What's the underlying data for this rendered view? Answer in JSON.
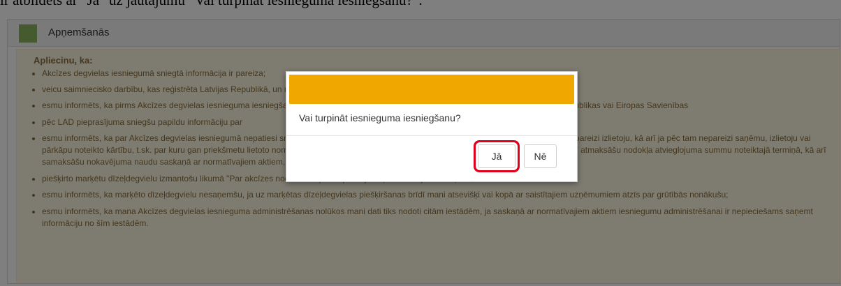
{
  "caption": "ir atbildēts ar \"Jā\" uz jautājumu \"Vai turpināt iesnieguma iesniegšanu?\".",
  "panel": {
    "title": "Apņemšanās",
    "heading": "Apliecinu, ka:",
    "items": [
      "Akcīzes degvielas iesniegumā sniegtā informācija ir pareiza;",
      "veicu saimniecisko darbību, kas reģistrēta Latvijas Republikā, un ražoju lauksaimniecisko vai akvakultūras produkciju;",
      "esmu informēts, ka pirms Akcīzes degvielas iesnieguma iesniegšanas un trīs gadus pēc akcīzes nodokļa atbrīvojuma saņemšanas Latvijas Republikas vai Eiropas Savienības",
      "pēc LAD pieprasījuma sniegšu papildu informāciju par",
      "esmu informēts, ka par Akcīzes degvielas iesniegumā nepatiesi sniegtām ziņām nepamatoti saņemtajām summām, ja nelikumīgi saņēmu vai nepareizi izlietoju, kā arī ja pēc tam nepareizi saņēmu, izlietoju vai pārkāpu noteikto kārtību, t.sk. par kuru gan priekšmetu lietoto normatīvu atbalstu, dēļ kura vai daļēji zaudēšu akcīzes nodokļa atbrīvojumu, kā arī atmaksāšu nodokļa atvieglojuma summu noteiktajā termiņā, kā arī samaksāšu nokavējuma naudu saskaņā ar normatīvajiem aktiem, ja samaksas termiņu nokavēšu;",
      "piešķirto marķētu dīzeļdegvielu izmantošu likumā \"Par akcīzes nodokli\" 18.panta piektajā daļā noteiktajiem mērķiem;",
      "esmu informēts, ka marķēto dīzeļdegvielu nesaņemšu, ja uz marķētas dīzeļdegvielas piešķiršanas brīdī mani atsevišķi vai kopā ar saistītajiem uzņēmumiem atzīs par grūtībās nonākušu;",
      "esmu informēts, ka mana Akcīzes degvielas iesnieguma administrēšanas nolūkos mani dati tiks nodoti citām iestādēm, ja saskaņā ar normatīvajiem aktiem iesniegumu administrēšanai ir nepieciešams saņemt informāciju no šīm iestādēm."
    ]
  },
  "dialog": {
    "message": "Vai turpināt iesnieguma iesniegšanu?",
    "yes_label": "Jā",
    "no_label": "Nē"
  },
  "colors": {
    "header_bar": "#f0a800",
    "highlight": "#e0001b",
    "panel_icon": "#8cb45f"
  }
}
